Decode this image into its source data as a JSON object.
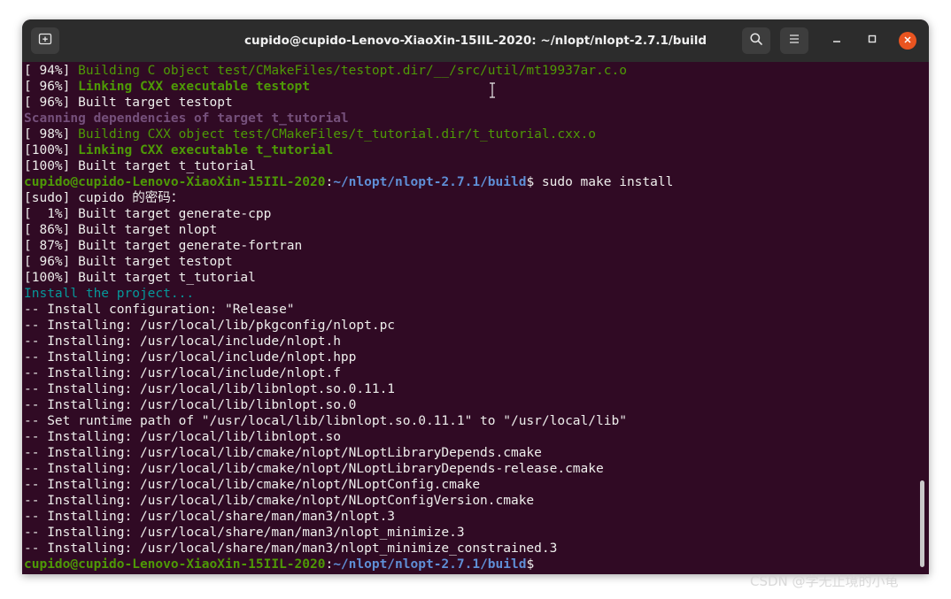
{
  "window": {
    "title": "cupido@cupido-Lenovo-XiaoXin-15IIL-2020: ~/nlopt/nlopt-2.7.1/build"
  },
  "toolbar": {
    "new_tab_icon": "new-tab-icon",
    "search_icon": "search-icon",
    "menu_icon": "hamburger-menu-icon",
    "minimize_icon": "minimize-icon",
    "maximize_icon": "maximize-icon",
    "close_icon": "close-icon"
  },
  "colors": {
    "terminal_bg": "#300a24",
    "titlebar_bg": "#2c2c2c",
    "green": "#4e9a06",
    "purple": "#75507b",
    "cyan": "#06989a",
    "blue": "#5f8fd6",
    "close_orange": "#e95420"
  },
  "terminal": {
    "lines": [
      {
        "segments": [
          {
            "text": "[ 94%] ",
            "style": "white"
          },
          {
            "text": "Building C object test/CMakeFiles/testopt.dir/__/src/util/mt19937ar.c.o",
            "style": "green"
          }
        ]
      },
      {
        "segments": [
          {
            "text": "[ 96%] ",
            "style": "white"
          },
          {
            "text": "Linking CXX executable testopt",
            "style": "green-bold"
          }
        ]
      },
      {
        "segments": [
          {
            "text": "[ 96%] Built target testopt",
            "style": "white"
          }
        ]
      },
      {
        "segments": [
          {
            "text": "Scanning dependencies of target t_tutorial",
            "style": "purple-bold"
          }
        ]
      },
      {
        "segments": [
          {
            "text": "[ 98%] ",
            "style": "white"
          },
          {
            "text": "Building CXX object test/CMakeFiles/t_tutorial.dir/t_tutorial.cxx.o",
            "style": "green"
          }
        ]
      },
      {
        "segments": [
          {
            "text": "[100%] ",
            "style": "white"
          },
          {
            "text": "Linking CXX executable t_tutorial",
            "style": "green-bold"
          }
        ]
      },
      {
        "segments": [
          {
            "text": "[100%] Built target t_tutorial",
            "style": "white"
          }
        ]
      },
      {
        "segments": [
          {
            "text": "cupido@cupido-Lenovo-XiaoXin-15IIL-2020",
            "style": "prompt-user"
          },
          {
            "text": ":",
            "style": "white"
          },
          {
            "text": "~/nlopt/nlopt-2.7.1/build",
            "style": "prompt-path"
          },
          {
            "text": "$ sudo make install",
            "style": "white"
          }
        ]
      },
      {
        "segments": [
          {
            "text": "[sudo] cupido 的密码：",
            "style": "white"
          }
        ]
      },
      {
        "segments": [
          {
            "text": "[  1%] Built target generate-cpp",
            "style": "white"
          }
        ]
      },
      {
        "segments": [
          {
            "text": "[ 86%] Built target nlopt",
            "style": "white"
          }
        ]
      },
      {
        "segments": [
          {
            "text": "[ 87%] Built target generate-fortran",
            "style": "white"
          }
        ]
      },
      {
        "segments": [
          {
            "text": "[ 96%] Built target testopt",
            "style": "white"
          }
        ]
      },
      {
        "segments": [
          {
            "text": "[100%] Built target t_tutorial",
            "style": "white"
          }
        ]
      },
      {
        "segments": [
          {
            "text": "Install the project...",
            "style": "cyan"
          }
        ]
      },
      {
        "segments": [
          {
            "text": "-- Install configuration: \"Release\"",
            "style": "white"
          }
        ]
      },
      {
        "segments": [
          {
            "text": "-- Installing: /usr/local/lib/pkgconfig/nlopt.pc",
            "style": "white"
          }
        ]
      },
      {
        "segments": [
          {
            "text": "-- Installing: /usr/local/include/nlopt.h",
            "style": "white"
          }
        ]
      },
      {
        "segments": [
          {
            "text": "-- Installing: /usr/local/include/nlopt.hpp",
            "style": "white"
          }
        ]
      },
      {
        "segments": [
          {
            "text": "-- Installing: /usr/local/include/nlopt.f",
            "style": "white"
          }
        ]
      },
      {
        "segments": [
          {
            "text": "-- Installing: /usr/local/lib/libnlopt.so.0.11.1",
            "style": "white"
          }
        ]
      },
      {
        "segments": [
          {
            "text": "-- Installing: /usr/local/lib/libnlopt.so.0",
            "style": "white"
          }
        ]
      },
      {
        "segments": [
          {
            "text": "-- Set runtime path of \"/usr/local/lib/libnlopt.so.0.11.1\" to \"/usr/local/lib\"",
            "style": "white"
          }
        ]
      },
      {
        "segments": [
          {
            "text": "-- Installing: /usr/local/lib/libnlopt.so",
            "style": "white"
          }
        ]
      },
      {
        "segments": [
          {
            "text": "-- Installing: /usr/local/lib/cmake/nlopt/NLoptLibraryDepends.cmake",
            "style": "white"
          }
        ]
      },
      {
        "segments": [
          {
            "text": "-- Installing: /usr/local/lib/cmake/nlopt/NLoptLibraryDepends-release.cmake",
            "style": "white"
          }
        ]
      },
      {
        "segments": [
          {
            "text": "-- Installing: /usr/local/lib/cmake/nlopt/NLoptConfig.cmake",
            "style": "white"
          }
        ]
      },
      {
        "segments": [
          {
            "text": "-- Installing: /usr/local/lib/cmake/nlopt/NLoptConfigVersion.cmake",
            "style": "white"
          }
        ]
      },
      {
        "segments": [
          {
            "text": "-- Installing: /usr/local/share/man/man3/nlopt.3",
            "style": "white"
          }
        ]
      },
      {
        "segments": [
          {
            "text": "-- Installing: /usr/local/share/man/man3/nlopt_minimize.3",
            "style": "white"
          }
        ]
      },
      {
        "segments": [
          {
            "text": "-- Installing: /usr/local/share/man/man3/nlopt_minimize_constrained.3",
            "style": "white"
          }
        ]
      },
      {
        "segments": [
          {
            "text": "cupido@cupido-Lenovo-XiaoXin-15IIL-2020",
            "style": "prompt-user"
          },
          {
            "text": ":",
            "style": "white"
          },
          {
            "text": "~/nlopt/nlopt-2.7.1/build",
            "style": "prompt-path"
          },
          {
            "text": "$",
            "style": "white"
          }
        ]
      }
    ]
  },
  "watermark": {
    "text": "CSDN @学无止境的小龟"
  }
}
